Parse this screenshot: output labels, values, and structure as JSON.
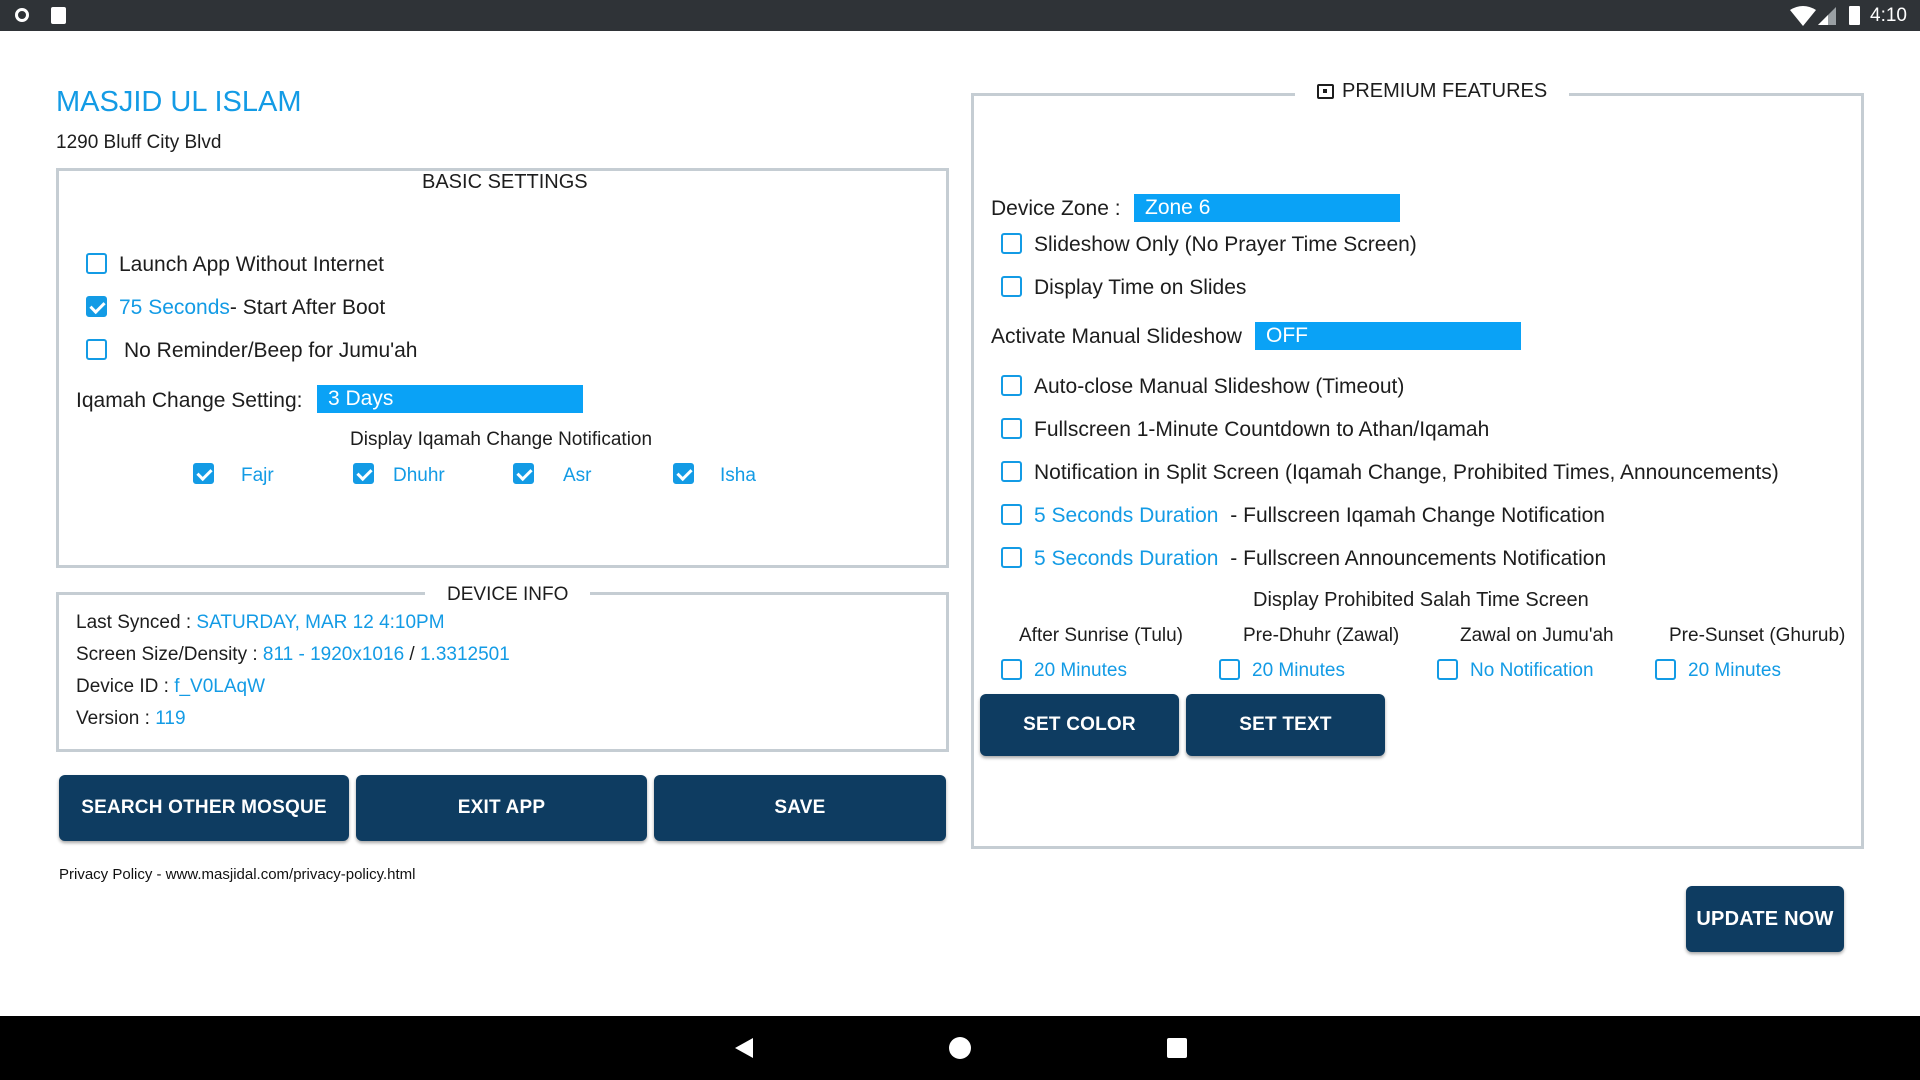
{
  "status_bar": {
    "time": "4:10"
  },
  "header": {
    "title": "MASJID UL ISLAM",
    "address": "1290 Bluff City Blvd"
  },
  "basic_settings": {
    "legend": "BASIC SETTINGS",
    "launch_without_internet": "Launch App Without Internet",
    "start_after_boot_value": "75 Seconds",
    "start_after_boot_label": "- Start After Boot",
    "no_reminder": "No Reminder/Beep for Jumu'ah",
    "iqamah_change_label": "Iqamah Change Setting:",
    "iqamah_change_value": "3 Days",
    "notification_heading": "Display Iqamah Change Notification",
    "prayers": [
      "Fajr",
      "Dhuhr",
      "Asr",
      "Isha"
    ]
  },
  "device_info": {
    "legend": "DEVICE INFO",
    "last_synced_label": "Last Synced :",
    "last_synced_value": "SATURDAY, MAR 12 4:10PM",
    "screen_label": "Screen Size/Density :",
    "screen_size": "811 - 1920x1016",
    "screen_sep": "/",
    "screen_density": "1.3312501",
    "device_id_label": "Device ID :",
    "device_id_value": "f_V0LAqW",
    "version_label": "Version :",
    "version_value": "119"
  },
  "buttons": {
    "search_other_mosque": "SEARCH OTHER MOSQUE",
    "exit_app": "EXIT APP",
    "save": "SAVE",
    "set_color": "SET COLOR",
    "set_text": "SET TEXT",
    "update_now": "UPDATE NOW"
  },
  "privacy_policy": "Privacy Policy - www.masjidal.com/privacy-policy.html",
  "premium": {
    "legend": "PREMIUM FEATURES",
    "device_zone_label": "Device Zone :",
    "device_zone_value": "Zone 6",
    "slideshow_only": "Slideshow Only (No  Prayer Time Screen)",
    "display_time_on_slides": "Display Time on Slides",
    "manual_slideshow_label": "Activate Manual Slideshow",
    "manual_slideshow_value": "OFF",
    "auto_close": "Auto-close Manual Slideshow (Timeout)",
    "fullscreen_countdown": "Fullscreen 1-Minute Countdown to Athan/Iqamah",
    "split_screen": "Notification in Split Screen (Iqamah Change, Prohibited Times, Announcements)",
    "iqamah_duration_value": "5 Seconds Duration",
    "iqamah_duration_label": "- Fullscreen Iqamah Change Notification",
    "announce_duration_value": "5 Seconds Duration",
    "announce_duration_label": "- Fullscreen Announcements Notification",
    "prohibited_heading": "Display Prohibited Salah Time Screen",
    "prohibited": [
      {
        "label": "After Sunrise (Tulu)",
        "value": "20 Minutes"
      },
      {
        "label": "Pre-Dhuhr (Zawal)",
        "value": "20 Minutes"
      },
      {
        "label": "Zawal on Jumu'ah",
        "value": "No Notification"
      },
      {
        "label": "Pre-Sunset (Ghurub)",
        "value": "20 Minutes"
      }
    ]
  },
  "colors": {
    "accent": "#139be5",
    "field": "#0aa2f6",
    "button": "#0e3c61",
    "border": "#c5cdd3"
  }
}
